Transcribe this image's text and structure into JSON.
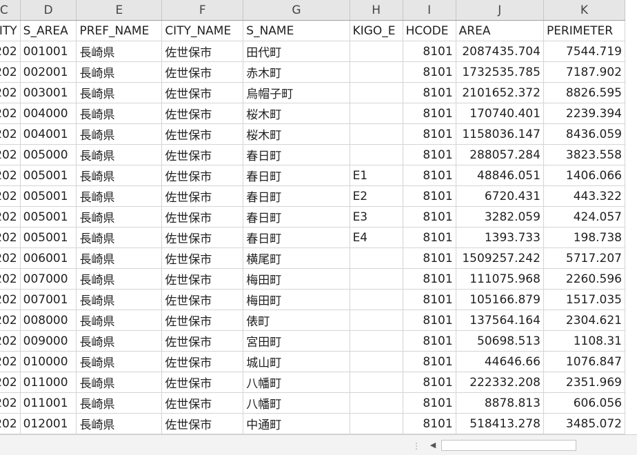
{
  "columns": [
    "C",
    "D",
    "E",
    "F",
    "G",
    "H",
    "I",
    "J",
    "K"
  ],
  "field_headers": [
    "CITY",
    "S_AREA",
    "PREF_NAME",
    "CITY_NAME",
    "S_NAME",
    "KIGO_E",
    "HCODE",
    "AREA",
    "PERIMETER"
  ],
  "rows": [
    [
      "202",
      "001001",
      "長崎県",
      "佐世保市",
      "田代町",
      "",
      "8101",
      "2087435.704",
      "7544.719"
    ],
    [
      "202",
      "002001",
      "長崎県",
      "佐世保市",
      "赤木町",
      "",
      "8101",
      "1732535.785",
      "7187.902"
    ],
    [
      "202",
      "003001",
      "長崎県",
      "佐世保市",
      "烏帽子町",
      "",
      "8101",
      "2101652.372",
      "8826.595"
    ],
    [
      "202",
      "004000",
      "長崎県",
      "佐世保市",
      "桜木町",
      "",
      "8101",
      "170740.401",
      "2239.394"
    ],
    [
      "202",
      "004001",
      "長崎県",
      "佐世保市",
      "桜木町",
      "",
      "8101",
      "1158036.147",
      "8436.059"
    ],
    [
      "202",
      "005000",
      "長崎県",
      "佐世保市",
      "春日町",
      "",
      "8101",
      "288057.284",
      "3823.558"
    ],
    [
      "202",
      "005001",
      "長崎県",
      "佐世保市",
      "春日町",
      "E1",
      "8101",
      "48846.051",
      "1406.066"
    ],
    [
      "202",
      "005001",
      "長崎県",
      "佐世保市",
      "春日町",
      "E2",
      "8101",
      "6720.431",
      "443.322"
    ],
    [
      "202",
      "005001",
      "長崎県",
      "佐世保市",
      "春日町",
      "E3",
      "8101",
      "3282.059",
      "424.057"
    ],
    [
      "202",
      "005001",
      "長崎県",
      "佐世保市",
      "春日町",
      "E4",
      "8101",
      "1393.733",
      "198.738"
    ],
    [
      "202",
      "006001",
      "長崎県",
      "佐世保市",
      "横尾町",
      "",
      "8101",
      "1509257.242",
      "5717.207"
    ],
    [
      "202",
      "007000",
      "長崎県",
      "佐世保市",
      "梅田町",
      "",
      "8101",
      "111075.968",
      "2260.596"
    ],
    [
      "202",
      "007001",
      "長崎県",
      "佐世保市",
      "梅田町",
      "",
      "8101",
      "105166.879",
      "1517.035"
    ],
    [
      "202",
      "008000",
      "長崎県",
      "佐世保市",
      "俵町",
      "",
      "8101",
      "137564.164",
      "2304.621"
    ],
    [
      "202",
      "009000",
      "長崎県",
      "佐世保市",
      "宮田町",
      "",
      "8101",
      "50698.513",
      "1108.31"
    ],
    [
      "202",
      "010000",
      "長崎県",
      "佐世保市",
      "城山町",
      "",
      "8101",
      "44646.66",
      "1076.847"
    ],
    [
      "202",
      "011000",
      "長崎県",
      "佐世保市",
      "八幡町",
      "",
      "8101",
      "222332.208",
      "2351.969"
    ],
    [
      "202",
      "011001",
      "長崎県",
      "佐世保市",
      "八幡町",
      "",
      "8101",
      "8878.813",
      "606.056"
    ],
    [
      "202",
      "012001",
      "長崎県",
      "佐世保市",
      "中通町",
      "",
      "8101",
      "518413.278",
      "3485.072"
    ]
  ],
  "scrollbar": {
    "left_arrow_icon": "chevron-left-icon"
  }
}
